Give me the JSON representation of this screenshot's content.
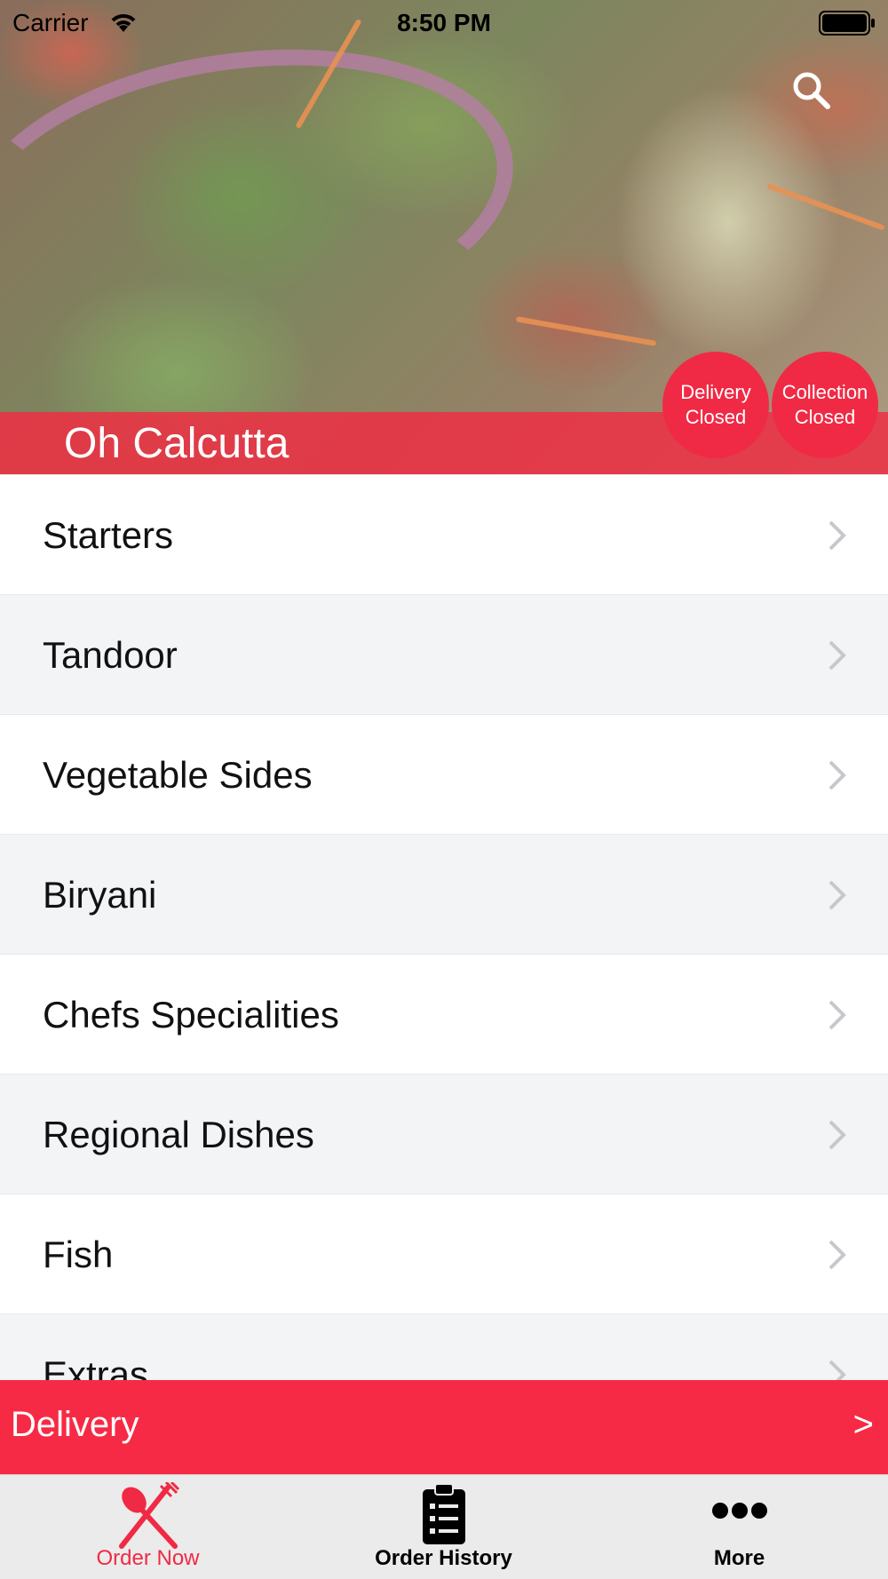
{
  "status_bar": {
    "carrier": "Carrier",
    "time": "8:50 PM"
  },
  "hero": {
    "restaurant_name": "Oh Calcutta",
    "delivery_status": {
      "line1": "Delivery",
      "line2": "Closed"
    },
    "collection_status": {
      "line1": "Collection",
      "line2": "Closed"
    },
    "search_icon": "search-icon"
  },
  "menu": {
    "categories": [
      {
        "label": "Starters"
      },
      {
        "label": "Tandoor"
      },
      {
        "label": "Vegetable Sides"
      },
      {
        "label": "Biryani"
      },
      {
        "label": "Chefs Specialities"
      },
      {
        "label": "Regional Dishes"
      },
      {
        "label": "Fish"
      },
      {
        "label": "Extras"
      }
    ]
  },
  "order_bar": {
    "label": "Delivery",
    "arrow": ">"
  },
  "tab_bar": {
    "tabs": [
      {
        "label": "Order Now",
        "icon": "fork-knife-icon",
        "active": true
      },
      {
        "label": "Order History",
        "icon": "clipboard-list-icon",
        "active": false
      },
      {
        "label": "More",
        "icon": "more-dots-icon",
        "active": false
      }
    ]
  },
  "colors": {
    "accent": "#f02a45",
    "delivery_bar": "#f72a45",
    "list_alt_row": "#f3f4f6",
    "tab_bar_bg": "#ebebeb"
  }
}
